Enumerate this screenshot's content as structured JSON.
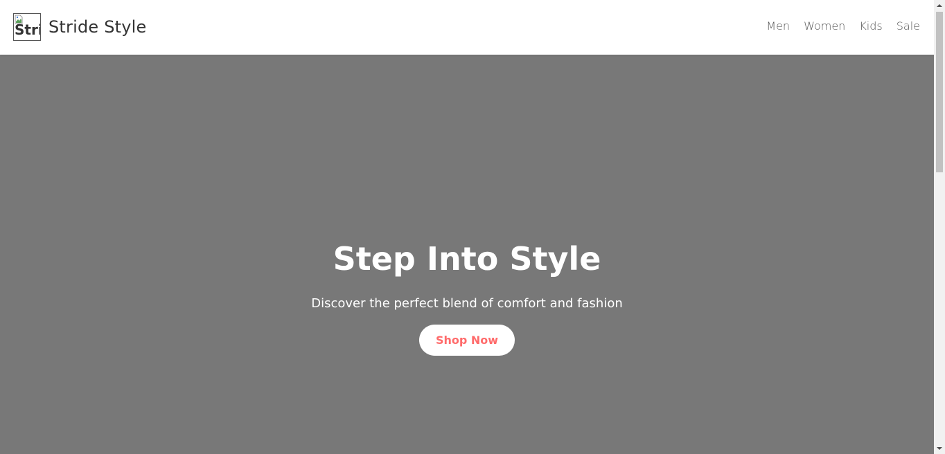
{
  "header": {
    "brand_name": "Stride Style",
    "logo_alt_text": "Stri",
    "nav": [
      {
        "label": "Men"
      },
      {
        "label": "Women"
      },
      {
        "label": "Kids"
      },
      {
        "label": "Sale"
      }
    ]
  },
  "hero": {
    "title": "Step Into Style",
    "subtitle": "Discover the perfect blend of comfort and fashion",
    "cta_label": "Shop Now"
  },
  "colors": {
    "hero_background": "#787878",
    "cta_text": "#ff6b6b",
    "header_background": "#ffffff",
    "brand_text": "#333333"
  },
  "icons": {
    "logo": "broken-image-icon",
    "scroll_up": "chevron-up-icon",
    "scroll_down": "chevron-down-icon"
  }
}
